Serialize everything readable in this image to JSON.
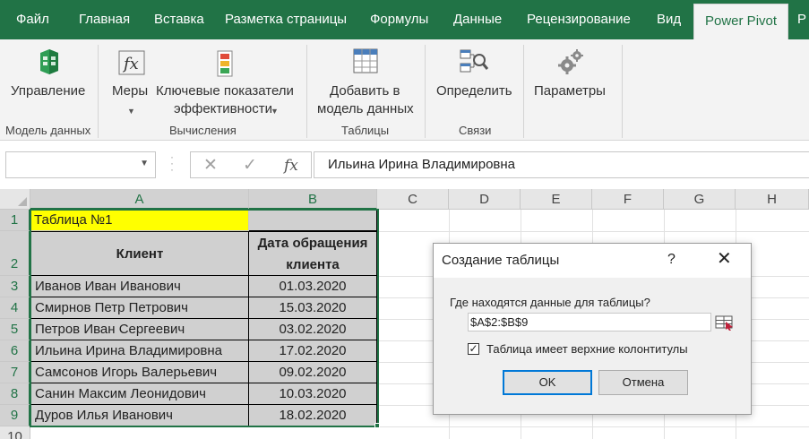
{
  "ribbon_tabs": [
    {
      "label": "Файл"
    },
    {
      "label": "Главная"
    },
    {
      "label": "Вставка"
    },
    {
      "label": "Разметка страницы"
    },
    {
      "label": "Формулы"
    },
    {
      "label": "Данные"
    },
    {
      "label": "Рецензирование"
    },
    {
      "label": "Вид"
    },
    {
      "label": "Power Pivot",
      "active": true
    },
    {
      "label": "Р"
    }
  ],
  "ribbon": {
    "groups": {
      "data_model": "Модель данных",
      "calculations": "Вычисления",
      "tables": "Таблицы",
      "relationships": "Связи"
    },
    "buttons": {
      "manage": "Управление",
      "measures": "Меры",
      "kpi_line1": "Ключевые показатели",
      "kpi_line2": "эффективности",
      "add_line1": "Добавить в",
      "add_line2": "модель данных",
      "detect": "Определить",
      "settings": "Параметры"
    },
    "icons": {
      "manage": "power-pivot-icon",
      "measures": "function-fx-icon",
      "kpi": "kpi-icon",
      "add": "table-add-icon",
      "detect": "relationship-detect-icon",
      "settings": "gears-icon"
    }
  },
  "formula_bar": {
    "name_box": "",
    "cancel_glyph": "✕",
    "enter_glyph": "✓",
    "fx_glyph": "fx",
    "content": "Ильина Ирина Владимировна"
  },
  "columns": [
    "A",
    "B",
    "C",
    "D",
    "E",
    "F",
    "G",
    "H"
  ],
  "rows": [
    "1",
    "2",
    "3",
    "4",
    "5",
    "6",
    "7",
    "8",
    "9",
    "10"
  ],
  "sheet": {
    "title_cell": "Таблица №1",
    "header_client": "Клиент",
    "header_date_line1": "Дата обращения",
    "header_date_line2": "клиента",
    "records": [
      {
        "client": "Иванов Иван Иванович",
        "date": "01.03.2020"
      },
      {
        "client": "Смирнов Петр Петрович",
        "date": "15.03.2020"
      },
      {
        "client": "Петров Иван Сергеевич",
        "date": "03.02.2020"
      },
      {
        "client": "Ильина Ирина Владимировна",
        "date": "17.02.2020"
      },
      {
        "client": "Самсонов Игорь Валерьевич",
        "date": "09.02.2020"
      },
      {
        "client": "Санин Максим Леонидович",
        "date": "10.03.2020"
      },
      {
        "client": "Дуров Илья Иванович",
        "date": "18.02.2020"
      }
    ]
  },
  "dialog": {
    "title": "Создание таблицы",
    "help": "?",
    "close": "✕",
    "prompt": "Где находятся данные для таблицы?",
    "range_value": "$A$2:$B$9",
    "checkbox_checked": true,
    "checkbox_mark": "✓",
    "checkbox_label": "Таблица имеет верхние колонтитулы",
    "ok": "OK",
    "cancel": "Отмена"
  },
  "colors": {
    "excel_green": "#217346",
    "gray_fill": "#d0d0d0",
    "yellow_fill": "#ffff00",
    "focus_blue": "#0078d7"
  }
}
